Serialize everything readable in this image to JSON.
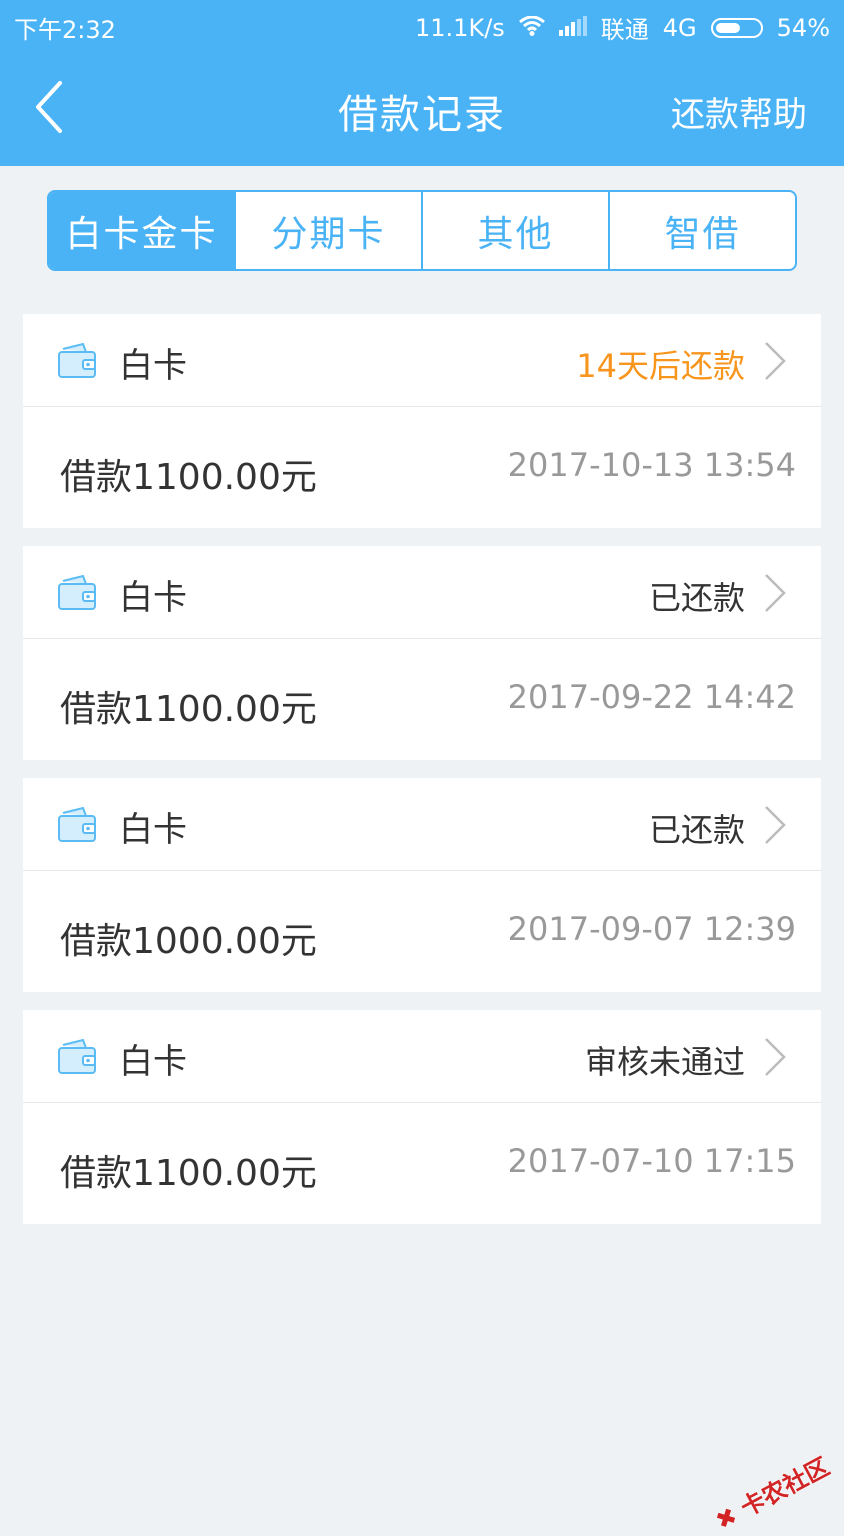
{
  "status_bar": {
    "time": "下午2:32",
    "net_speed": "11.1K/s",
    "carrier": "联通",
    "network": "4G",
    "battery": "54%"
  },
  "nav": {
    "title": "借款记录",
    "help": "还款帮助"
  },
  "tabs": [
    "白卡金卡",
    "分期卡",
    "其他",
    "智借"
  ],
  "records": [
    {
      "type": "白卡",
      "status": "14天后还款",
      "amount": "借款1100.00元",
      "date": "2017-10-13 13:54"
    },
    {
      "type": "白卡",
      "status": "已还款",
      "amount": "借款1100.00元",
      "date": "2017-09-22 14:42"
    },
    {
      "type": "白卡",
      "status": "已还款",
      "amount": "借款1000.00元",
      "date": "2017-09-07 12:39"
    },
    {
      "type": "白卡",
      "status": "审核未通过",
      "amount": "借款1100.00元",
      "date": "2017-07-10 17:15"
    }
  ],
  "watermark": "卡农社区",
  "colors": {
    "primary": "#4ab3f6",
    "due_status": "#f8951d",
    "background": "#eff2f5"
  }
}
